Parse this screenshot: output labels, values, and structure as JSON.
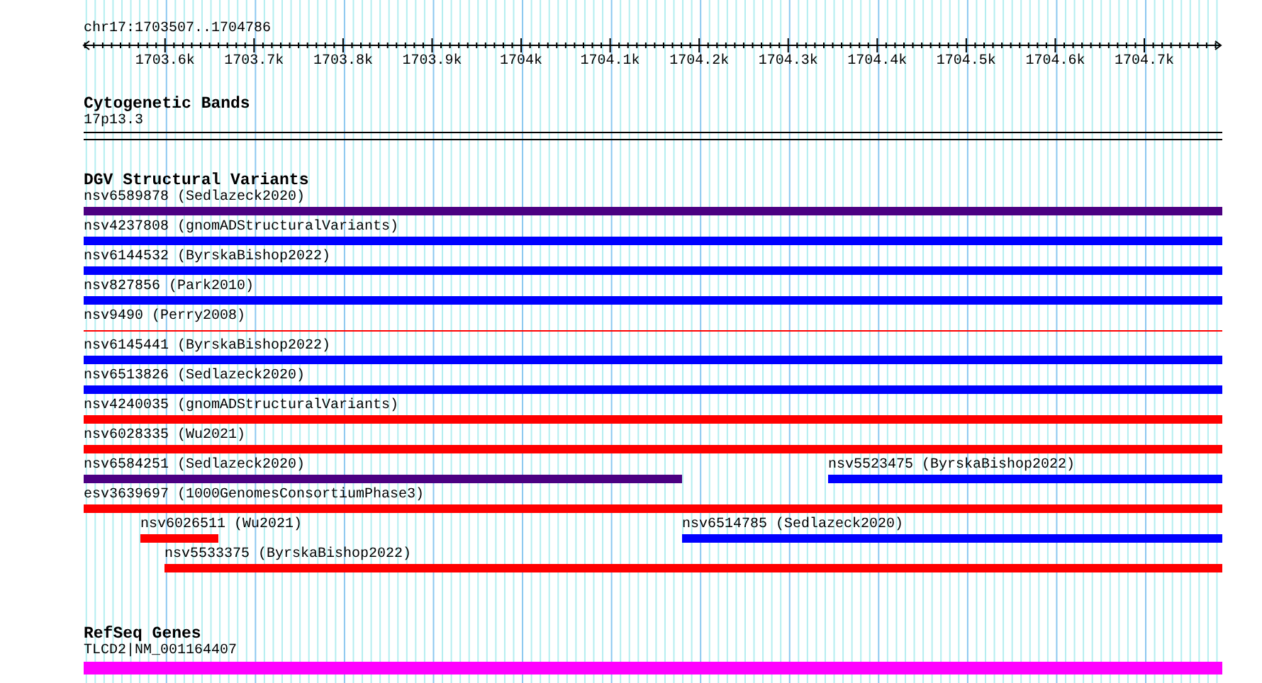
{
  "ruler": {
    "location": "chr17:1703507..1704786",
    "tick_labels": [
      "1703.6k",
      "1703.7k",
      "1703.8k",
      "1703.9k",
      "1704k",
      "1704.1k",
      "1704.2k",
      "1704.3k",
      "1704.4k",
      "1704.5k",
      "1704.6k",
      "1704.7k"
    ]
  },
  "cytogenetic_bands": {
    "title": "Cytogenetic Bands",
    "band": "17p13.3"
  },
  "dgv_track": {
    "title": "DGV Structural Variants",
    "rows": [
      [
        {
          "label": "nsv6589878 (Sedlazeck2020)",
          "color": "#4b0082",
          "kind": "bar"
        }
      ],
      [
        {
          "label": "nsv4237808 (gnomADStructuralVariants)",
          "color": "#0000ff",
          "kind": "bar"
        }
      ],
      [
        {
          "label": "nsv6144532 (ByrskaBishop2022)",
          "color": "#0000ff",
          "kind": "bar"
        }
      ],
      [
        {
          "label": "nsv827856 (Park2010)",
          "color": "#0000ff",
          "kind": "bar"
        }
      ],
      [
        {
          "label": "nsv9490 (Perry2008)",
          "color": "#ff0000",
          "kind": "line"
        }
      ],
      [
        {
          "label": "nsv6145441 (ByrskaBishop2022)",
          "color": "#0000ff",
          "kind": "bar"
        }
      ],
      [
        {
          "label": "nsv6513826 (Sedlazeck2020)",
          "color": "#0000ff",
          "kind": "bar"
        }
      ],
      [
        {
          "label": "nsv4240035 (gnomADStructuralVariants)",
          "color": "#ff0000",
          "kind": "bar"
        }
      ],
      [
        {
          "label": "nsv6028335 (Wu2021)",
          "color": "#ff0000",
          "kind": "bar"
        }
      ],
      [
        {
          "label": "nsv6584251 (Sedlazeck2020)",
          "color": "#4b0082",
          "kind": "bar"
        },
        {
          "label": "nsv5523475 (ByrskaBishop2022)",
          "color": "#0000ff",
          "kind": "bar"
        }
      ],
      [
        {
          "label": "esv3639697 (1000GenomesConsortiumPhase3)",
          "color": "#ff0000",
          "kind": "bar"
        }
      ],
      [
        {
          "label": "nsv6026511 (Wu2021)",
          "color": "#ff0000",
          "kind": "bar"
        },
        {
          "label": "nsv6514785 (Sedlazeck2020)",
          "color": "#0000ff",
          "kind": "bar"
        }
      ],
      [
        {
          "label": "nsv5533375 (ByrskaBishop2022)",
          "color": "#ff0000",
          "kind": "bar"
        }
      ]
    ]
  },
  "refseq_track": {
    "title": "RefSeq Genes",
    "genes": [
      {
        "label": "TLCD2|NM_001164407"
      }
    ]
  }
}
